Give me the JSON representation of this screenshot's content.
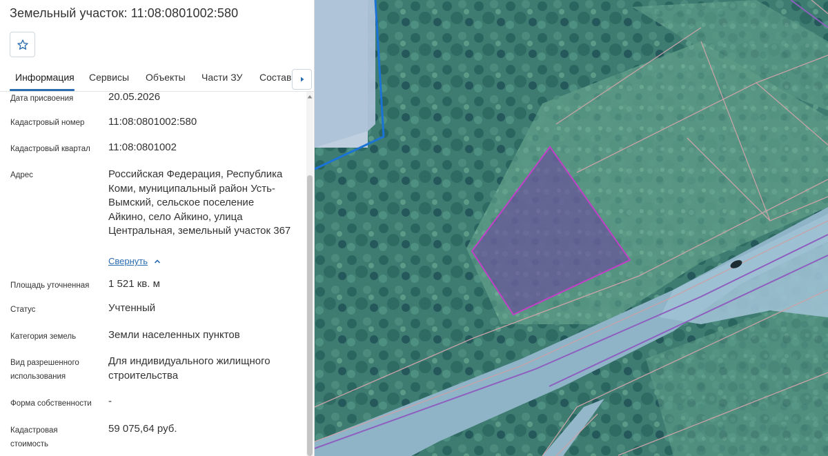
{
  "panel": {
    "title": "Земельный участок: 11:08:0801002:580",
    "favorite_icon": "star-outline-icon",
    "tab_next_icon": "caret-right-icon"
  },
  "tabs": [
    {
      "label": "Информация",
      "active": true
    },
    {
      "label": "Сервисы",
      "active": false
    },
    {
      "label": "Объекты",
      "active": false
    },
    {
      "label": "Части ЗУ",
      "active": false
    },
    {
      "label": "Состав",
      "active": false
    }
  ],
  "info": {
    "assign_date": {
      "label": "Дата присвоения",
      "value": "20.05.2026"
    },
    "cadastral_number": {
      "label": "Кадастровый номер",
      "value": "11:08:0801002:580"
    },
    "cadastral_quarter": {
      "label": "Кадастровый квартал",
      "value": "11:08:0801002"
    },
    "address": {
      "label": "Адрес",
      "value": "Российская Федерация, Республика Коми, муниципальный район Усть-Вымский, сельское поселение Айкино, село Айкино, улица Центральная, земельный участок 367",
      "collapse_label": "Свернуть"
    },
    "area": {
      "label": "Площадь уточненная",
      "value": "1 521 кв. м"
    },
    "status": {
      "label": "Статус",
      "value": "Учтенный"
    },
    "land_category": {
      "label": "Категория земель",
      "value": "Земли населенных пунктов"
    },
    "permitted_use": {
      "label": "Вид разрешенного использования",
      "value": "Для индивидуального жилищного строительства"
    },
    "ownership": {
      "label": "Форма собственности",
      "value": "-"
    },
    "cadastral_value": {
      "label": "Кадастровая стоимость",
      "value": "59 075,64 руб."
    }
  },
  "colors": {
    "accent": "#2a6cb0",
    "selected_parcel": "#b03ab5",
    "parcel_border": "#c9a2a8",
    "block_border": "#1a73d6"
  }
}
